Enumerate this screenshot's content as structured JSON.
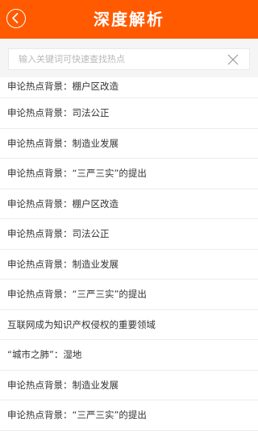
{
  "header": {
    "title": "深度解析"
  },
  "search": {
    "placeholder": "输入关键词可快速查找热点",
    "value": ""
  },
  "colors": {
    "header_bg": "#ff5a00",
    "search_bg": "#f5f5f5",
    "text": "#333333",
    "placeholder": "#b8b8b8",
    "divider": "#ececec"
  },
  "icons": {
    "back": "chevron-left-circle",
    "clear": "close-x"
  },
  "articles": [
    {
      "title": "申论热点背景：棚户区改造"
    },
    {
      "title": "申论热点背景：司法公正"
    },
    {
      "title": "申论热点背景：制造业发展"
    },
    {
      "title": "申论热点背景：“三严三实”的提出"
    },
    {
      "title": "申论热点背景：棚户区改造"
    },
    {
      "title": "申论热点背景：司法公正"
    },
    {
      "title": "申论热点背景：制造业发展"
    },
    {
      "title": "申论热点背景：“三严三实”的提出"
    },
    {
      "title": "互联网成为知识产权侵权的重要领域"
    },
    {
      "title": "“城市之肺”：湿地"
    },
    {
      "title": "申论热点背景：制造业发展"
    },
    {
      "title": "申论热点背景：“三严三实”的提出"
    }
  ]
}
